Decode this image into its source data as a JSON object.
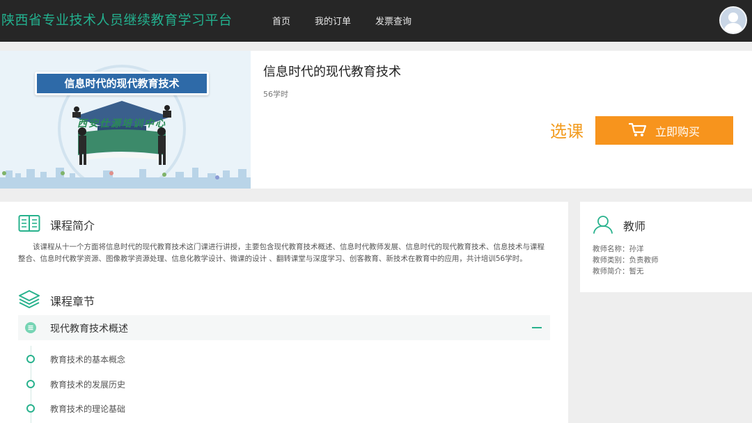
{
  "header": {
    "site_title": "陕西省专业技术人员继续教育学习平台",
    "nav": {
      "home": "首页",
      "orders": "我的订单",
      "invoice": "发票查询"
    },
    "avatar_icon": "user-avatar-icon"
  },
  "course": {
    "banner_title": "信息时代的现代教育技术",
    "banner_seal": "西安仕源培训中心",
    "title": "信息时代的现代教育技术",
    "hours": "56学时",
    "select_label": "选课",
    "buy_label": "立即购买",
    "buy_icon": "cart-icon"
  },
  "intro": {
    "heading": "课程简介",
    "heading_icon": "book-icon",
    "text": "该课程从十一个方面将信息时代的现代教育技术这门课进行讲授，主要包含现代教育技术概述、信息时代教师发展、信息时代的现代教育技术、信息技术与课程整合、信息时代教学资源、图像教学资源处理、信息化教学设计、微课的设计 、翻转课堂与深度学习、创客教育、新技术在教育中的应用，共计培训56学时。"
  },
  "chapters": {
    "heading": "课程章节",
    "heading_icon": "layers-icon",
    "current": {
      "title": "现代教育技术概述",
      "lessons": [
        "教育技术的基本概念",
        "教育技术的发展历史",
        "教育技术的理论基础"
      ]
    }
  },
  "teacher": {
    "heading": "教师",
    "heading_icon": "person-icon",
    "name_row": "教师名称：孙洋",
    "type_row": "教师类别：负责教师",
    "bio_row": "教师简介：暂无"
  },
  "colors": {
    "brand_green": "#23b08e",
    "header_bg": "#262626",
    "accent_orange": "#f7941d",
    "select_orange": "#f29b1e"
  }
}
